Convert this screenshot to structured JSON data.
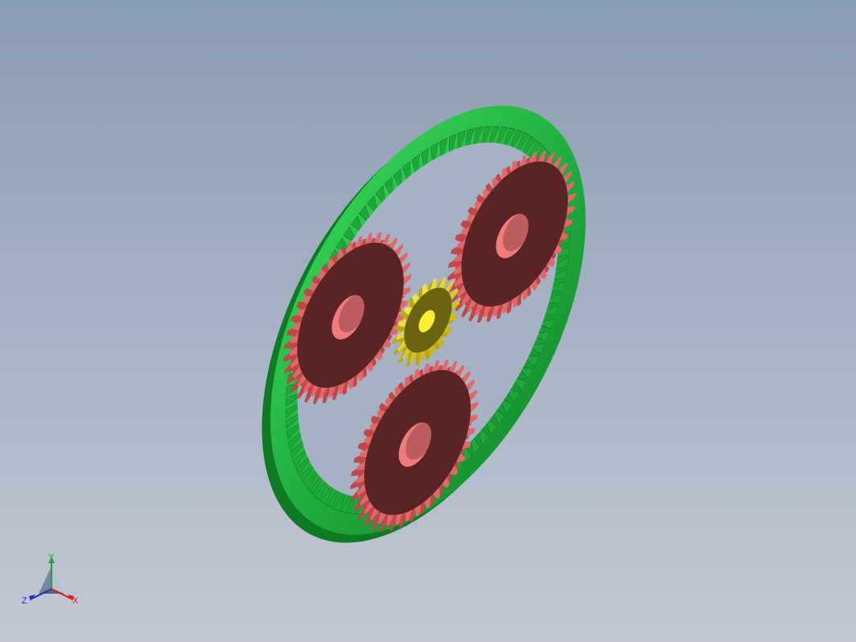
{
  "viewport": {
    "background_top": "#8a9cb3",
    "background_bottom": "#c3c8d3"
  },
  "assembly": {
    "ring_gear": {
      "name": "ring-gear",
      "color": "#2fbf4a",
      "teeth": 96
    },
    "planet_gears": [
      {
        "name": "planet-gear-upper-left",
        "color": "#e0686a",
        "face_color": "#5a2424",
        "teeth": 36
      },
      {
        "name": "planet-gear-upper-right",
        "color": "#e0686a",
        "face_color": "#5a2424",
        "teeth": 36
      },
      {
        "name": "planet-gear-bottom",
        "color": "#e0686a",
        "face_color": "#5a2424",
        "teeth": 36
      }
    ],
    "sun_gear": {
      "name": "sun-gear",
      "color": "#e5d41c",
      "face_color": "#6a6410",
      "teeth": 18
    }
  },
  "triad": {
    "x_label": "X",
    "y_label": "Y",
    "z_label": "Z",
    "x_color": "#d42020",
    "y_color": "#20a040",
    "z_color": "#2030c0"
  }
}
